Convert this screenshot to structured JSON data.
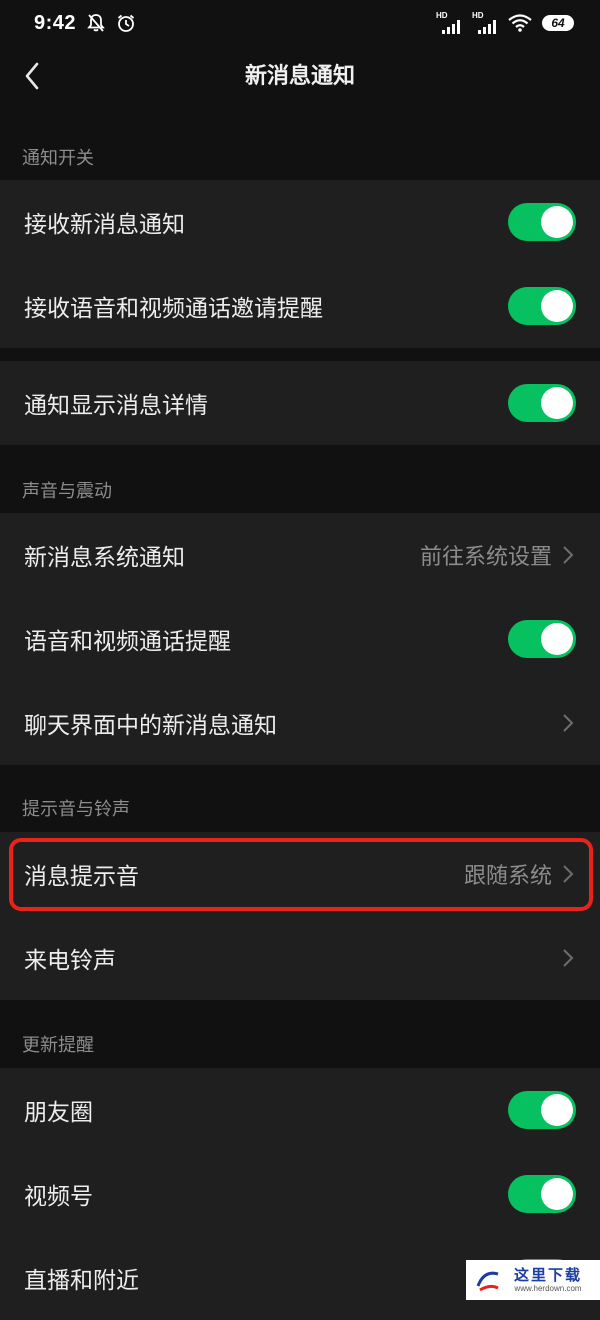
{
  "status_bar": {
    "time": "9:42",
    "battery": "64",
    "hd_label": "HD"
  },
  "nav": {
    "title": "新消息通知"
  },
  "sections": {
    "notify_switch": "通知开关",
    "sound_vibration": "声音与震动",
    "tones": "提示音与铃声",
    "updates": "更新提醒"
  },
  "rows": {
    "receive_new": {
      "label": "接收新消息通知",
      "enabled": true
    },
    "receive_call_invite": {
      "label": "接收语音和视频通话邀请提醒",
      "enabled": true
    },
    "show_details": {
      "label": "通知显示消息详情",
      "enabled": true
    },
    "system_notify": {
      "label": "新消息系统通知",
      "value": "前往系统设置"
    },
    "call_reminder": {
      "label": "语音和视频通话提醒",
      "enabled": true
    },
    "chat_notify": {
      "label": "聊天界面中的新消息通知"
    },
    "message_tone": {
      "label": "消息提示音",
      "value": "跟随系统"
    },
    "ringtone": {
      "label": "来电铃声"
    },
    "moments": {
      "label": "朋友圈",
      "enabled": true
    },
    "channels": {
      "label": "视频号",
      "enabled": true
    },
    "live_nearby": {
      "label": "直播和附近",
      "enabled": true
    }
  },
  "colors": {
    "toggle_on": "#07c160",
    "highlight": "#e8231a",
    "background": "#111111",
    "cell": "#1f1f1f"
  },
  "icons": {
    "back": "back-arrow-icon",
    "chevron": "chevron-right-icon",
    "mute": "bell-off-icon",
    "alarm": "alarm-clock-icon",
    "wifi": "wifi-icon"
  },
  "watermark": {
    "text": "这里下载",
    "url": "www.herdown.com"
  }
}
